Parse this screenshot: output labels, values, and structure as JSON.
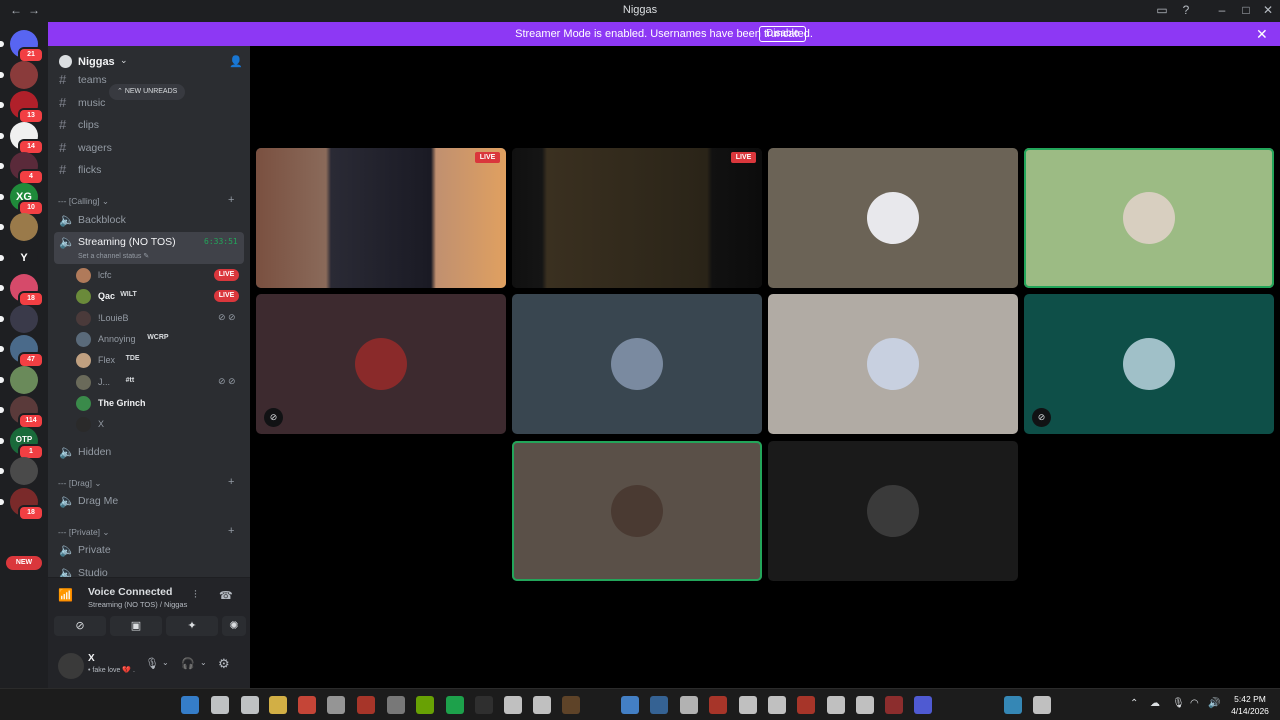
{
  "window": {
    "title": "Niggas",
    "back_icon": "←",
    "forward_icon": "→"
  },
  "banner": {
    "message": "Streamer Mode is enabled. Usernames have been truncated.",
    "disable_label": "Disable",
    "close_icon": "✕"
  },
  "guilds": [
    {
      "badge": "21",
      "color": "#5865f2",
      "icon": "discord-home-icon"
    },
    {
      "badge": "",
      "color": "#8a3b3b"
    },
    {
      "badge": "13",
      "color": "#b0202a"
    },
    {
      "badge": "14",
      "color": "#f0f0f0"
    },
    {
      "badge": "4",
      "color": "#5a2a3a"
    },
    {
      "badge": "10",
      "color": "#1f8a3a",
      "text": "XG"
    },
    {
      "badge": "",
      "color": "#9a7a4a"
    },
    {
      "badge": "",
      "color": "#1e1f22",
      "text": "Y"
    },
    {
      "badge": "18",
      "color": "#d64a6a"
    },
    {
      "badge": "",
      "color": "#3a3a4a"
    },
    {
      "badge": "47",
      "color": "#4a6a8a"
    },
    {
      "badge": "",
      "color": "#6a8a5a"
    },
    {
      "badge": "114",
      "color": "#5a3a3a"
    },
    {
      "badge": "1",
      "color": "#1a6a3a",
      "text": "OTP"
    },
    {
      "badge": "",
      "color": "#4a4a4a"
    },
    {
      "badge": "18",
      "color": "#7a2a2a"
    }
  ],
  "guild_new_label": "NEW",
  "server": {
    "name": "Niggas",
    "new_unreads": "NEW UNREADS"
  },
  "channels_top": [
    {
      "label": "teams"
    },
    {
      "label": "music"
    },
    {
      "label": "clips"
    },
    {
      "label": "wagers"
    },
    {
      "label": "flicks"
    }
  ],
  "categories": {
    "calling": "--- [Calling]",
    "drag": "--- [Drag]",
    "private": "--- [Private]"
  },
  "voice_channels": {
    "backblock": "Backblock",
    "streaming": "Streaming (NO TOS)",
    "timer": "6:33:51",
    "status_hint": "Set a channel status",
    "hidden": "Hidden",
    "drag_me": "Drag Me",
    "private": "Private",
    "studio": "Studio"
  },
  "members": [
    {
      "name": "lcfc",
      "tag": "",
      "live": true,
      "muted": false,
      "bold": false,
      "color": "#b07a5a"
    },
    {
      "name": "Qac",
      "tag": "WILT",
      "live": true,
      "muted": false,
      "bold": true,
      "color": "#6a8a3a"
    },
    {
      "name": "!LouieB",
      "tag": "",
      "live": false,
      "muted": true,
      "bold": false,
      "color": "#4a3a3a"
    },
    {
      "name": "Annoying",
      "tag": "WCRP",
      "live": false,
      "muted": false,
      "bold": false,
      "color": "#5a6a7a"
    },
    {
      "name": "Flex",
      "tag": "TDE",
      "live": false,
      "muted": false,
      "bold": false,
      "color": "#c0a080"
    },
    {
      "name": "J...",
      "tag": "#tt",
      "live": false,
      "muted": true,
      "bold": false,
      "color": "#6a6a5a"
    },
    {
      "name": "The Grinch",
      "tag": "",
      "live": false,
      "muted": false,
      "bold": true,
      "color": "#3a8a4a"
    },
    {
      "name": "X",
      "tag": "",
      "live": false,
      "muted": false,
      "bold": false,
      "color": "#2a2a2a"
    }
  ],
  "live_label": "LIVE",
  "voice": {
    "status": "Voice Connected",
    "location": "Streaming (NO TOS) / Niggas",
    "status_color": "#23a55a"
  },
  "user": {
    "name": "X",
    "status": "• fake love 💔 ."
  },
  "tiles": [
    {
      "kind": "stream",
      "live": true,
      "bg": "#3a4a5a",
      "speaking": false,
      "muted": false
    },
    {
      "kind": "stream",
      "live": true,
      "bg": "#1a1a1a",
      "speaking": false,
      "muted": false
    },
    {
      "kind": "avatar",
      "live": false,
      "bg": "#6b6356",
      "avatar": "#e8e8ec",
      "speaking": false,
      "muted": false
    },
    {
      "kind": "avatar",
      "live": false,
      "bg": "#9cbb84",
      "avatar": "#d8cfc0",
      "speaking": true,
      "muted": false
    },
    {
      "kind": "avatar",
      "live": false,
      "bg": "#3d2a2f",
      "avatar": "#8a2a2a",
      "speaking": false,
      "muted": true
    },
    {
      "kind": "avatar",
      "live": false,
      "bg": "#394650",
      "avatar": "#7a8aa0",
      "speaking": false,
      "muted": false
    },
    {
      "kind": "avatar",
      "live": false,
      "bg": "#b1aba4",
      "avatar": "#c8d0e0",
      "speaking": false,
      "muted": false
    },
    {
      "kind": "avatar",
      "live": false,
      "bg": "#0e4f48",
      "avatar": "#a0c0c8",
      "speaking": false,
      "muted": true
    },
    {
      "kind": "avatar",
      "live": false,
      "bg": "#5a5048",
      "avatar": "#4a3a32",
      "speaking": true,
      "muted": false
    },
    {
      "kind": "avatar",
      "live": false,
      "bg": "#1a1a1a",
      "avatar": "#3a3a3a",
      "speaking": false,
      "muted": false
    }
  ],
  "taskbar": {
    "time": "5:42 PM",
    "date": "4/14/2026"
  }
}
